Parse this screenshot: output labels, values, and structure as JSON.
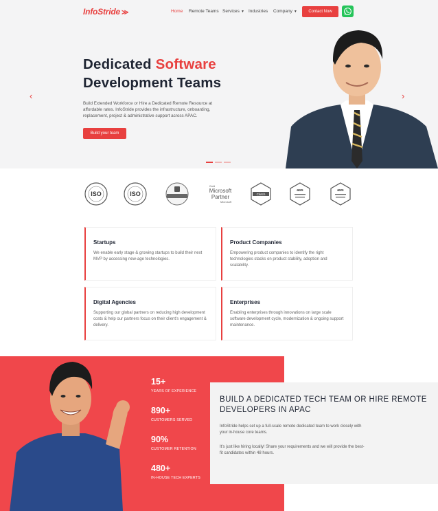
{
  "nav": {
    "logo": "InfoStride",
    "links": [
      {
        "label": "Home",
        "active": true
      },
      {
        "label": "Remote Teams"
      },
      {
        "label": "Services"
      },
      {
        "label": "Industries"
      },
      {
        "label": "Company"
      }
    ],
    "contact_label": "Contact Now",
    "whatsapp_icon": "whatsapp-icon"
  },
  "hero": {
    "title_part1": "Dedicated ",
    "title_accent": "Software",
    "title_part2": "Development Teams",
    "description": "Build Extended Workforce or Hire a Dedicated Remote Resource at affordable rates. InfoStride provides the infrastructure, onboarding, replacement, project & administrative support across APAC.",
    "cta_label": "Build your team",
    "prev_icon": "chevron-left-icon",
    "next_icon": "chevron-right-icon",
    "slide_count": 3,
    "active_slide": 1
  },
  "certs": [
    {
      "name": "iso-badge-1",
      "text": "ISO"
    },
    {
      "name": "iso-badge-2",
      "text": "ISO"
    },
    {
      "name": "goodfirms-badge",
      "text": "GoodFirms"
    },
    {
      "name": "microsoft-partner-badge",
      "line1": "Gold",
      "line2": "Microsoft",
      "line3": "Partner",
      "line4": "Microsoft"
    },
    {
      "name": "clutch-badge",
      "text": "Clutch"
    },
    {
      "name": "aws-practitioner-badge",
      "text": "aws"
    },
    {
      "name": "aws-architect-badge",
      "text": "aws"
    }
  ],
  "cards": [
    {
      "title": "Startups",
      "text": "We enable early stage & growing startups to build their next MVP by accessing new-age technologies."
    },
    {
      "title": "Product Companies",
      "text": "Empowering product companies to identify the right technologies stacks on product stability, adoption and scalability."
    },
    {
      "title": "Digital Agencies",
      "text": "Supporting our global partners on reducing high development costs & help our partners focus on their client's engagement & delivery."
    },
    {
      "title": "Enterprises",
      "text": "Enabling enterprises through innovations on large scale software development cycle, modernization & ongoing support maintenance."
    }
  ],
  "stats": [
    {
      "num": "15+",
      "label": "YEARS OF EXPERIENCE"
    },
    {
      "num": "890+",
      "label": "CUSTOMERS SERVED"
    },
    {
      "num": "90%",
      "label": "CUSTOMER RETENTION"
    },
    {
      "num": "480+",
      "label": "IN-HOUSE TECH EXPERTS"
    }
  ],
  "info": {
    "title": "BUILD A DEDICATED TECH TEAM OR HIRE REMOTE DEVELOPERS IN APAC",
    "p1": "InfoStride helps set up a full-scale remote dedicated team to work closely with your in-house core teams.",
    "p2": "It's just like hiring locally! Share your requirements and we will provide the best-fit candidates within 48 hours."
  },
  "colors": {
    "accent": "#e8403f",
    "dark": "#1f2533",
    "whatsapp": "#25c45a"
  }
}
